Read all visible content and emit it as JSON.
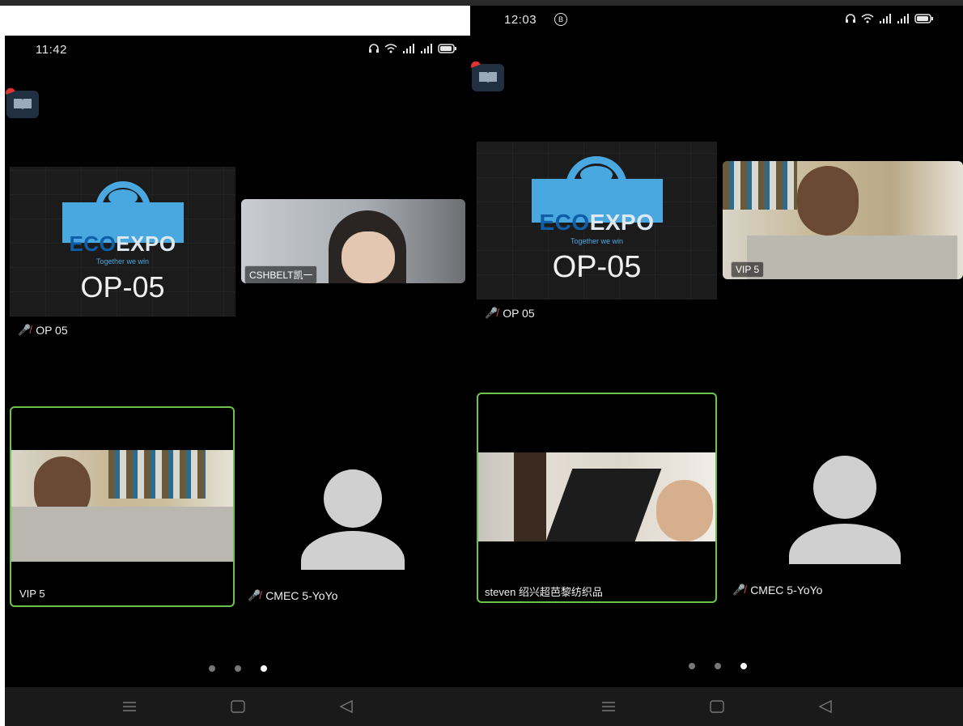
{
  "left": {
    "status": {
      "time": "11:42"
    },
    "tiles": {
      "op05": {
        "brand_main": "ECO",
        "brand_rest": "EXPO",
        "tagline": "Together we win",
        "code": "OP-05",
        "name": "OP 05"
      },
      "cshbelt": {
        "label": "CSHBELT凯一"
      },
      "vip5": {
        "name": "VIP 5"
      },
      "cmec": {
        "name": "CMEC 5-YoYo"
      }
    }
  },
  "right": {
    "status": {
      "time": "12:03"
    },
    "tiles": {
      "op05": {
        "brand_main": "ECO",
        "brand_rest": "EXPO",
        "tagline": "Together we win",
        "code": "OP-05",
        "name": "OP 05"
      },
      "vip5": {
        "label": "VIP 5"
      },
      "steven": {
        "name": "steven 绍兴超芭黎纺织品"
      },
      "cmec": {
        "name": "CMEC 5-YoYo"
      }
    }
  },
  "icons": {
    "status": [
      "headphones-icon",
      "wifi-icon",
      "signal-icon",
      "signal-icon",
      "battery-icon"
    ],
    "muted": "mic-off-icon",
    "app": "book-icon",
    "nav": [
      "menu-icon",
      "home-icon",
      "back-icon"
    ]
  },
  "colors": {
    "active_speaker": "#6cc34a",
    "background": "#000000",
    "muted": "#e05a4a",
    "eco_blue": "#4aa8e0"
  },
  "pager": {
    "pages": 3,
    "active_index": 2
  }
}
